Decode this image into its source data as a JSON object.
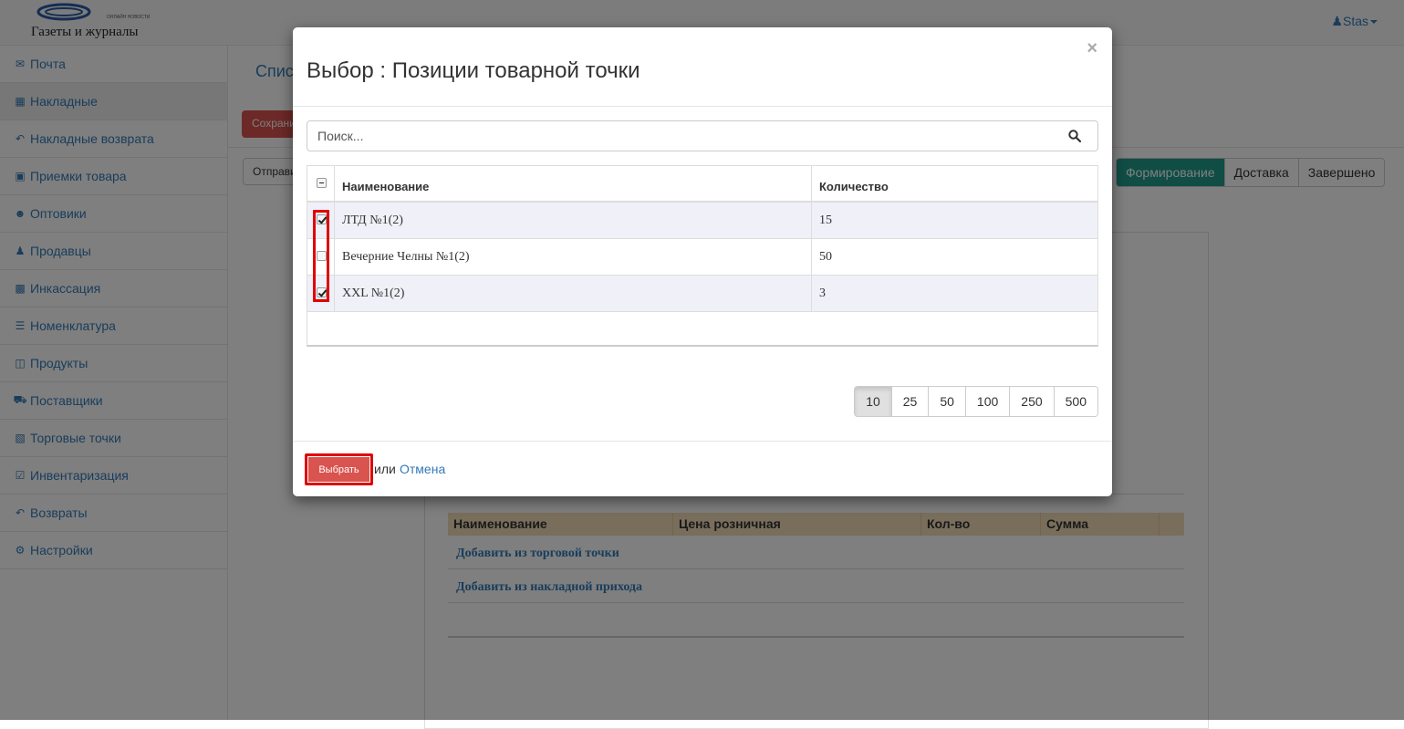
{
  "header": {
    "logo_tagline": "ОНЛАЙН НОВОСТИ",
    "logo_text": "Газеты и журналы",
    "user": "Stas"
  },
  "sidebar": {
    "items": [
      {
        "label": "Почта",
        "icon": "envelope-icon"
      },
      {
        "label": "Накладные",
        "icon": "table-icon"
      },
      {
        "label": "Накладные возврата",
        "icon": "reply-icon"
      },
      {
        "label": "Приемки товара",
        "icon": "cube-icon"
      },
      {
        "label": "Оптовики",
        "icon": "users-icon"
      },
      {
        "label": "Продавцы",
        "icon": "person-icon"
      },
      {
        "label": "Инкассация",
        "icon": "money-icon"
      },
      {
        "label": "Номенклатура",
        "icon": "list-icon"
      },
      {
        "label": "Продукты",
        "icon": "cubes-icon"
      },
      {
        "label": "Поставщики",
        "icon": "truck-icon"
      },
      {
        "label": "Торговые точки",
        "icon": "shop-icon"
      },
      {
        "label": "Инвентаризация",
        "icon": "checkbox-icon"
      },
      {
        "label": "Возвраты",
        "icon": "reply-icon"
      },
      {
        "label": "Настройки",
        "icon": "gears-icon"
      }
    ]
  },
  "background": {
    "title": "Спис",
    "save_button": "Сохранить",
    "send_button": "Отправить",
    "status_tabs": [
      "Формирование",
      "Доставка",
      "Завершено"
    ],
    "table_headers": [
      "Наименование",
      "Цена розничная",
      "Кол-во",
      "Сумма"
    ],
    "add_links": [
      "Добавить из торговой точки",
      "Добавить из накладной прихода"
    ]
  },
  "modal": {
    "title": "Выбор : Позиции товарной точки",
    "close": "×",
    "search_placeholder": "Поиск...",
    "columns": {
      "name": "Наименование",
      "qty": "Количество"
    },
    "rows": [
      {
        "name": "ЛТД №1(2)",
        "qty": "15",
        "checked": true
      },
      {
        "name": "Вечерние Челны №1(2)",
        "qty": "50",
        "checked": false
      },
      {
        "name": "XXL №1(2)",
        "qty": "3",
        "checked": true
      }
    ],
    "page_sizes": [
      "10",
      "25",
      "50",
      "100",
      "250",
      "500"
    ],
    "active_page_size": "10",
    "select_button": "Выбрать",
    "or_text": "или",
    "cancel_link": "Отмена"
  },
  "colors": {
    "accent_link": "#337ab7",
    "danger": "#d9534f",
    "status_active": "#1e9b8a",
    "highlight_box": "#e00000"
  }
}
